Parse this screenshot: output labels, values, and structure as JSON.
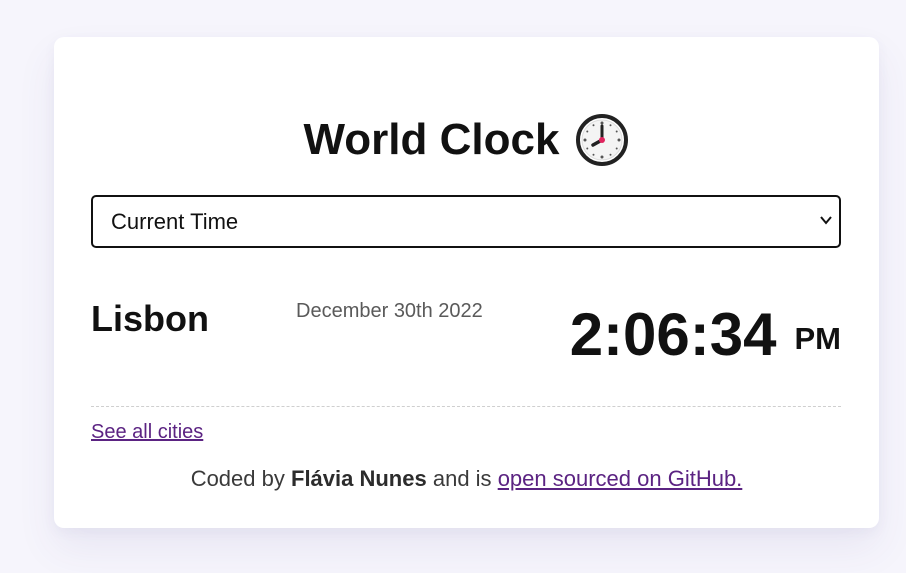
{
  "app": {
    "title": "World Clock"
  },
  "icons": {
    "title_icon": "clock-face-icon"
  },
  "selector": {
    "selected": "Current Time"
  },
  "city": {
    "name": "Lisbon",
    "date": "December 30th 2022",
    "time": "2:06:34",
    "ampm": "PM"
  },
  "links": {
    "see_all": "See all cities"
  },
  "footer": {
    "prefix": "Coded by",
    "author": "Flávia Nunes",
    "middle": "and is",
    "link": "open sourced on GitHub."
  },
  "colors": {
    "background": "#f6f5fc",
    "card": "#ffffff",
    "link": "#5b2382",
    "text": "#111111",
    "date": "#5a5a5a"
  }
}
